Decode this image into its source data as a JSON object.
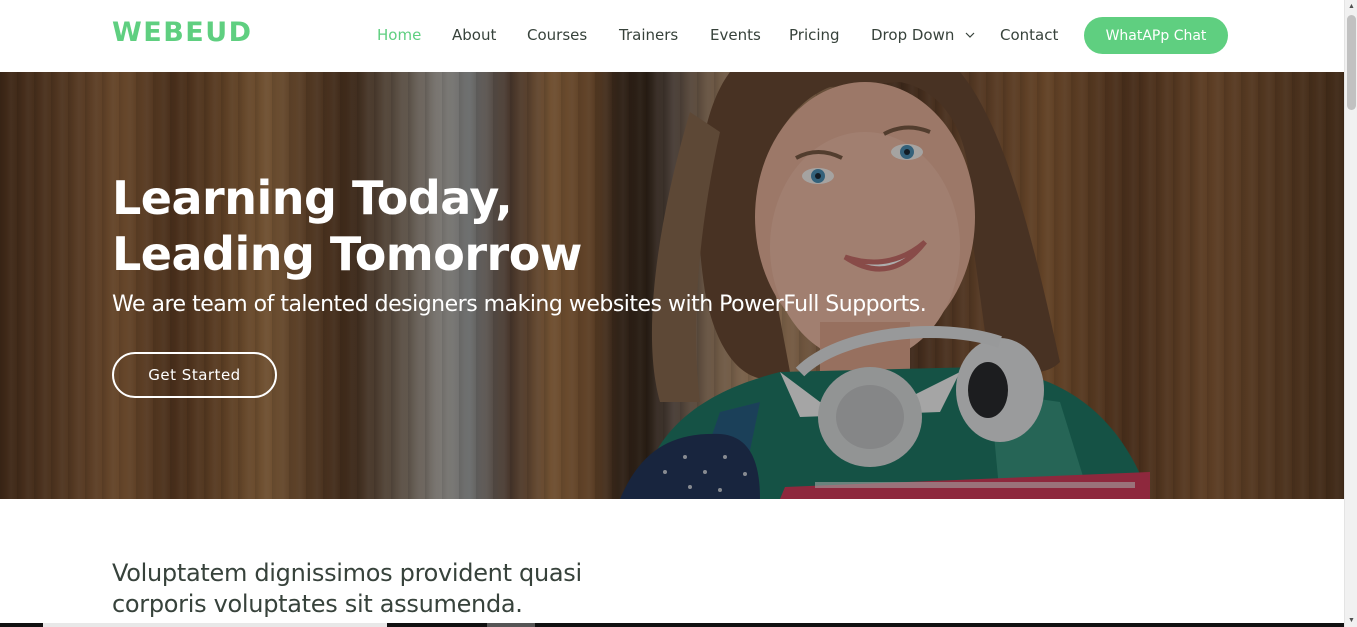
{
  "brand": {
    "name": "WEBEUD",
    "accent": "#5fcf80",
    "text_color": "#37423b"
  },
  "nav": {
    "items": [
      {
        "label": "Home",
        "active": true
      },
      {
        "label": "About",
        "active": false
      },
      {
        "label": "Courses",
        "active": false
      },
      {
        "label": "Trainers",
        "active": false
      },
      {
        "label": "Events",
        "active": false
      },
      {
        "label": "Pricing",
        "active": false
      },
      {
        "label": "Drop Down",
        "active": false,
        "has_dropdown": true,
        "icon": "chevron-down-icon"
      },
      {
        "label": "Contact",
        "active": false
      }
    ],
    "cta_label": "WhatAPp Chat"
  },
  "hero": {
    "title_line1": "Learning Today,",
    "title_line2": "Leading Tomorrow",
    "subtitle": "We are team of talented designers making websites with PowerFull Supports.",
    "button_label": "Get Started"
  },
  "about": {
    "intro": "Voluptatem dignissimos provident quasi corporis voluptates sit assumenda."
  }
}
